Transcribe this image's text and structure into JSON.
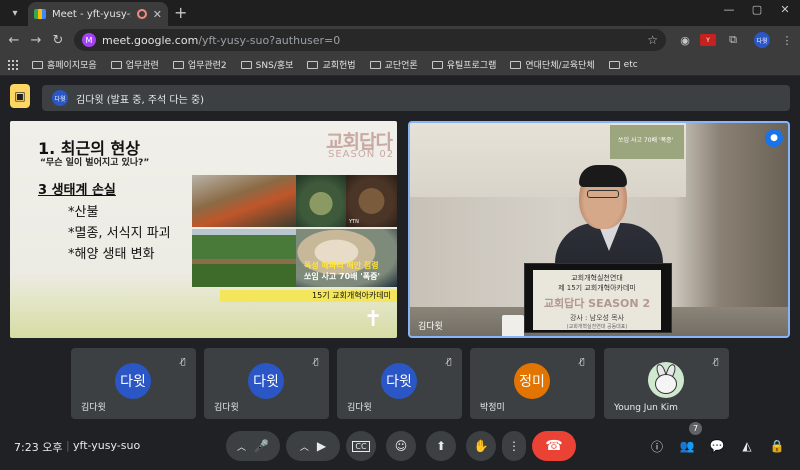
{
  "browser": {
    "tab_title": "Meet - yft-yusy-suo",
    "tab_close": "✕",
    "new_tab": "+",
    "window_controls": [
      "—",
      "▢",
      "✕"
    ]
  },
  "address": {
    "url_host": "meet.google.com",
    "url_path": "/yft-yusy-suo?authuser=0",
    "site_icon": "M",
    "profile": "다윗"
  },
  "bookmarks": [
    "홈페이지모음",
    "업무관련",
    "업무관련2",
    "SNS/홍보",
    "교회헌법",
    "교단언론",
    "유틸프로그램",
    "연대단체/교육단체",
    "etc"
  ],
  "presenting": {
    "avatar": "다윗",
    "text": "김다윗 (발표 중, 주석 다는 중)"
  },
  "slide": {
    "heading": "1. 최근의 현상",
    "subheading": "“무슨 일이 벌어지고 있나?”",
    "brand": "교회답다",
    "season": "SEASON 02",
    "section": "3 생태계 손실",
    "bullets": [
      "*산불",
      "*멸종, 서식지 파괴",
      "*해양 생태 변화"
    ],
    "photo_caption_1": "독성 해파리 해안 점령",
    "photo_caption_2": "쏘임 사고 70배 '폭증'",
    "photo_source": "YTN",
    "academy": "15기 교회개혁아카데미"
  },
  "camera": {
    "name": "김다윗",
    "podium_line1": "교회개혁실천연대",
    "podium_line2": "제 15기 교회개혁아카데미",
    "podium_title": "교회답다 SEASON 2",
    "podium_speaker": "강사 : 남오성 목사",
    "podium_org": "(교회개혁실천연대 공동대표)",
    "thumb_text": "쏘임 사고 70배 '폭증'"
  },
  "participants": [
    {
      "initials": "다윗",
      "name": "김다윗",
      "color": "#2a56c6"
    },
    {
      "initials": "다윗",
      "name": "김다윗",
      "color": "#2a56c6"
    },
    {
      "initials": "다윗",
      "name": "김다윗",
      "color": "#2a56c6"
    },
    {
      "initials": "정미",
      "name": "박정미",
      "color": "#e37400"
    },
    {
      "initials": "",
      "name": "Young Jun Kim",
      "color": "#cfe8d0"
    }
  ],
  "bottom": {
    "time": "7:23 오후",
    "separator": "|",
    "meeting_code": "yft-yusy-suo",
    "people_count": "7"
  }
}
